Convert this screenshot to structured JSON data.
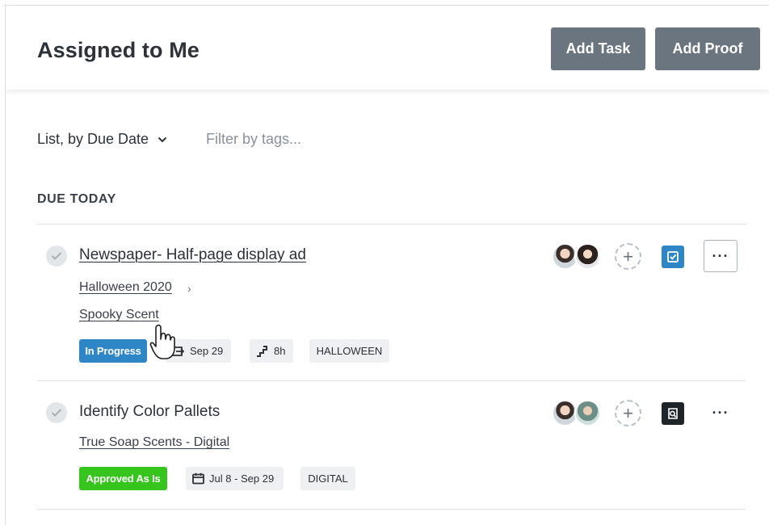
{
  "header": {
    "title": "Assigned to Me",
    "add_task_label": "Add Task",
    "add_proof_label": "Add Proof"
  },
  "toolbar": {
    "view_label": "List, by Due Date",
    "filter_placeholder": "Filter by tags..."
  },
  "section": {
    "title": "DUE TODAY"
  },
  "tasks": [
    {
      "title": "Newspaper- Half-page display ad",
      "project": "Halloween 2020",
      "subproject": "Spooky Scent",
      "status": "In Progress",
      "status_color": "#2f86c6",
      "due": "Sep 29",
      "effort": "8h",
      "tag": "HALLOWEEN",
      "type_icon": "task-checkbox-icon"
    },
    {
      "title": "Identify Color Pallets",
      "project": "True Soap Scents - Digital",
      "status": "Approved As Is",
      "status_color": "#35c51d",
      "due": "Jul 8 - Sep 29",
      "tag": "DIGITAL",
      "type_icon": "proof-review-icon"
    }
  ]
}
